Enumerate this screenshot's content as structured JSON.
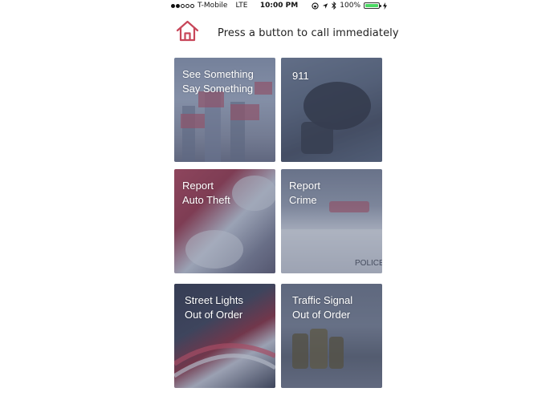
{
  "status_bar": {
    "carrier": "T-Mobile",
    "network": "LTE",
    "time": "10:00 PM",
    "battery": "100%",
    "signal_bars_filled": 2,
    "signal_bars_total": 5,
    "battery_level": 1.0,
    "battery_color": "#4cd964"
  },
  "header": {
    "home_icon": "home-icon",
    "home_icon_color": "#c8475a",
    "instruction": "Press a button to call immediately"
  },
  "tiles": [
    {
      "lines": [
        "See Something",
        "Say Something"
      ]
    },
    {
      "lines": [
        "911"
      ]
    },
    {
      "lines": [
        "Report",
        "Auto Theft"
      ]
    },
    {
      "lines": [
        "Report",
        "Crime"
      ]
    },
    {
      "lines": [
        "Street Lights",
        "Out of Order"
      ]
    },
    {
      "lines": [
        "Traffic Signal",
        "Out of Order"
      ]
    }
  ]
}
